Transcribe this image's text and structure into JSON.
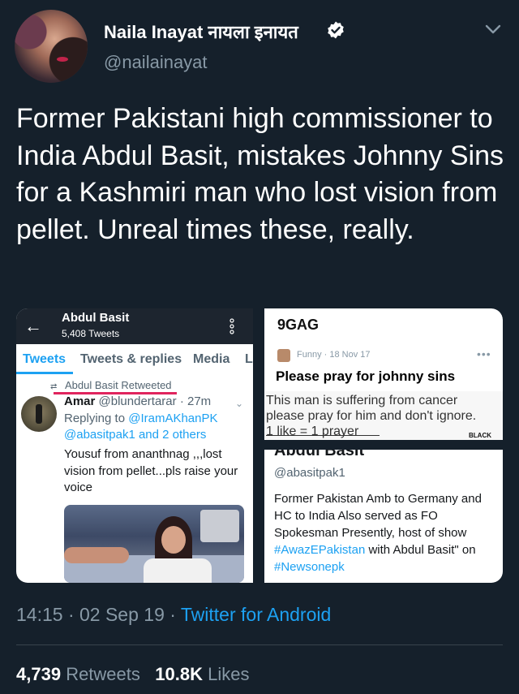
{
  "header": {
    "display_name": "Naila Inayat नायला इनायत",
    "handle": "@nailainayat"
  },
  "tweet": {
    "text": "Former Pakistani high commissioner to India Abdul Basit, mistakes Johnny Sins for a Kashmiri man who lost vision from pellet. Unreal times these, really."
  },
  "left_screenshot": {
    "back_icon": "←",
    "profile_name": "Abdul Basit",
    "tweet_count": "5,408 Tweets",
    "tabs": [
      "Tweets",
      "Tweets & replies",
      "Media",
      "L"
    ],
    "retweet_label": "Abdul Basit Retweeted",
    "author_name": "Amar",
    "author_handle": "@blundertarar",
    "author_time": "· 27m",
    "replying_prefix": "Replying to",
    "replying_mention": "@IramAKhanPK",
    "replying_others": "@abasitpak1 and 2 others",
    "body": "Yousuf from ananthnag ,,,lost vision from pellet...pls raise your voice"
  },
  "right_top": {
    "site": "9GAG",
    "meta": "Funny · 18 Nov 17",
    "dots": "•••",
    "post_title": "Please pray for johnny sins",
    "image_line1": "This man is suffering from cancer",
    "image_line2": "please pray for him and don't ignore.",
    "image_line3": "1 like = 1 prayer",
    "image_logo": "BLACK"
  },
  "right_bottom": {
    "name": "Abdul Basit",
    "handle": "@abasitpak1",
    "bio_text": "Former Pakistan Amb to Germany and HC to India Also served as FO Spokesman Presently, host of show",
    "bio_tag1": "#AwazEPakistan",
    "bio_mid": "with Abdul Basit\" on",
    "bio_tag2": "#Newsonepk"
  },
  "footer": {
    "time": "14:15 · 02 Sep 19 ·",
    "source": "Twitter for Android",
    "retweets_count": "4,739",
    "retweets_label": "Retweets",
    "likes_count": "10.8K",
    "likes_label": "Likes"
  },
  "colors": {
    "background": "#15202b",
    "accent": "#1da1f2",
    "secondary_text": "#8899a6"
  }
}
